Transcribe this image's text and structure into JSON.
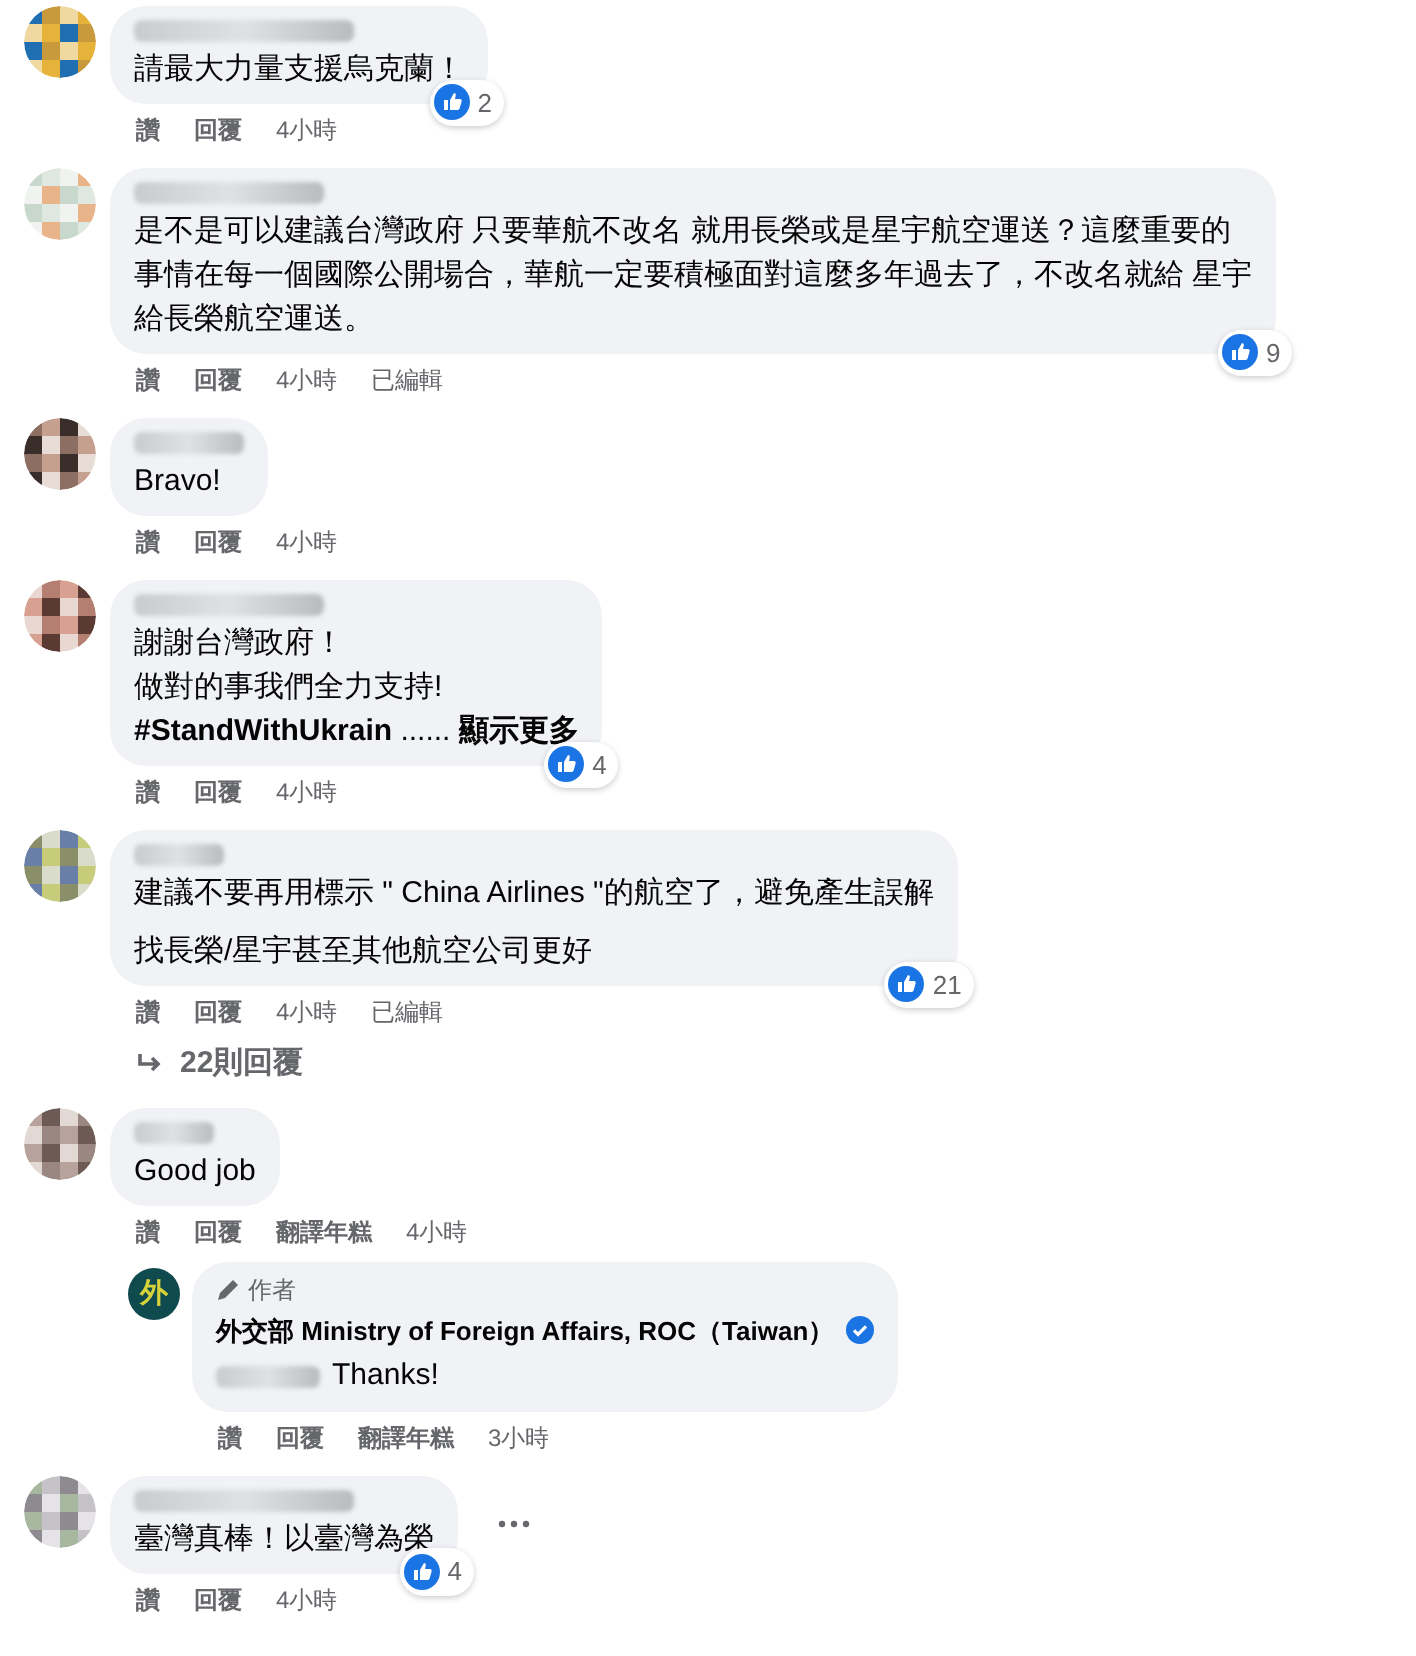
{
  "comments": [
    {
      "paragraphs": [
        [
          "請最大力量支援烏克蘭！"
        ]
      ],
      "reactions": "2",
      "actions": [
        "讚",
        "回覆"
      ],
      "time": "4小時"
    },
    {
      "paragraphs": [
        [
          "是不是可以建議台灣政府 只要華航不改名 就用長榮或是星宇航空運送？這麼重要的",
          "事情在每一個國際公開場合，華航一定要積極面對這麼多年過去了，不改名就給 星宇",
          "給長榮航空運送。"
        ]
      ],
      "reactions": "9",
      "actions": [
        "讚",
        "回覆"
      ],
      "time": "4小時",
      "edited": "已編輯"
    },
    {
      "paragraphs": [
        [
          "Bravo!"
        ]
      ],
      "actions": [
        "讚",
        "回覆"
      ],
      "time": "4小時"
    },
    {
      "paragraphs": [
        [
          "謝謝台灣政府！",
          "做對的事我們全力支持!",
          "**#StandWithUkrain** ...... **顯示更多**"
        ]
      ],
      "reactions": "4",
      "actions": [
        "讚",
        "回覆"
      ],
      "time": "4小時"
    },
    {
      "paragraphs": [
        [
          "建議不要再用標示 \" China Airlines \"的航空了，避免產生誤解"
        ],
        [
          "找長榮/星宇甚至其他航空公司更好"
        ]
      ],
      "reactions": "21",
      "actions": [
        "讚",
        "回覆"
      ],
      "time": "4小時",
      "edited": "已編輯",
      "replies_link": "22則回覆"
    },
    {
      "paragraphs": [
        [
          "Good job"
        ]
      ],
      "actions": [
        "讚",
        "回覆",
        "翻譯年糕"
      ],
      "time": "4小時",
      "reply": {
        "logo_text": "外",
        "badge": "作者",
        "author": "外交部 Ministry of Foreign Affairs, ROC（Taiwan）",
        "verified": true,
        "text": "Thanks!",
        "actions": [
          "讚",
          "回覆",
          "翻譯年糕"
        ],
        "time": "3小時"
      }
    },
    {
      "paragraphs": [
        [
          "臺灣真棒！以臺灣為榮"
        ]
      ],
      "reactions": "4",
      "actions": [
        "讚",
        "回覆"
      ],
      "time": "4小時",
      "more_button": true
    }
  ]
}
